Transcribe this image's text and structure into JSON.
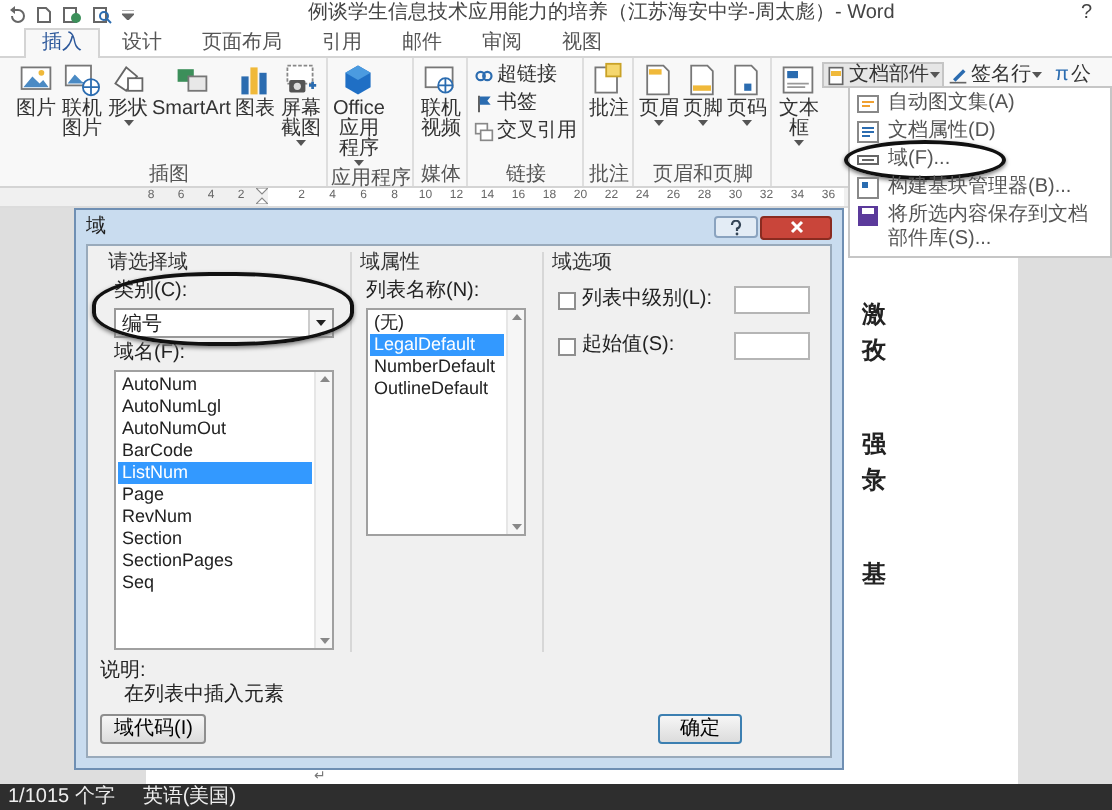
{
  "title_bar": {
    "title": "例谈学生信息技术应用能力的培养（江苏海安中学-周太彪）- Word",
    "help": "?"
  },
  "tabs": [
    {
      "label": "插入",
      "selected": true
    },
    {
      "label": "设计",
      "selected": false
    },
    {
      "label": "页面布局",
      "selected": false
    },
    {
      "label": "引用",
      "selected": false
    },
    {
      "label": "邮件",
      "selected": false
    },
    {
      "label": "审阅",
      "selected": false
    },
    {
      "label": "视图",
      "selected": false
    }
  ],
  "ribbon": {
    "groups": [
      {
        "label": "插图",
        "items": [
          {
            "kind": "large",
            "label": "图片",
            "dropdown": false
          },
          {
            "kind": "large",
            "label": "联机图片",
            "dropdown": false
          },
          {
            "kind": "large",
            "label": "形状",
            "dropdown": true
          },
          {
            "kind": "large",
            "label": "SmartArt",
            "dropdown": false
          },
          {
            "kind": "large",
            "label": "图表",
            "dropdown": false
          },
          {
            "kind": "large",
            "label": "屏幕截图",
            "dropdown": true
          }
        ]
      },
      {
        "label": "应用程序",
        "items": [
          {
            "kind": "large",
            "label": "Office",
            "sublabel": "应用程序",
            "dropdown": true
          }
        ]
      },
      {
        "label": "媒体",
        "items": [
          {
            "kind": "large",
            "label": "联机视频",
            "dropdown": false
          }
        ]
      },
      {
        "label": "链接",
        "items": [
          {
            "kind": "column",
            "buttons": [
              {
                "label": "超链接",
                "dropdown": false,
                "pressed": false
              },
              {
                "label": "书签",
                "dropdown": false,
                "pressed": false
              },
              {
                "label": "交叉引用",
                "dropdown": false,
                "pressed": false
              }
            ]
          }
        ]
      },
      {
        "label": "批注",
        "items": [
          {
            "kind": "large",
            "label": "批注",
            "dropdown": false
          }
        ]
      },
      {
        "label": "页眉和页脚",
        "items": [
          {
            "kind": "large",
            "label": "页眉",
            "dropdown": true
          },
          {
            "kind": "large",
            "label": "页脚",
            "dropdown": true
          },
          {
            "kind": "large",
            "label": "页码",
            "dropdown": true
          }
        ]
      },
      {
        "items": [
          {
            "kind": "large",
            "label": "文本框",
            "dropdown": true
          },
          {
            "kind": "column",
            "buttons": [
              {
                "label": "文档部件",
                "dropdown": true,
                "pressed": true
              }
            ]
          },
          {
            "kind": "column",
            "buttons": [
              {
                "label": "签名行",
                "dropdown": true,
                "pressed": false
              }
            ]
          }
        ]
      },
      {
        "items": [
          {
            "kind": "column",
            "buttons": [
              {
                "symbol": "π",
                "label": "公",
                "dropdown": false,
                "pressed": false
              }
            ]
          }
        ]
      }
    ]
  },
  "menu": {
    "items": [
      {
        "label": "自动图文集(A)",
        "circled": false
      },
      {
        "label": "文档属性(D)",
        "circled": false
      },
      {
        "label": "域(F)...",
        "circled": true
      },
      {
        "label": "构建基块管理器(B)...",
        "circled": false
      },
      {
        "label": "将所选内容保存到文档部件库(S)...",
        "circled": false
      }
    ]
  },
  "ruler": {
    "left_marks": [
      "8",
      "6",
      "4",
      "2"
    ],
    "right_marks": [
      "2",
      "4",
      "6",
      "8",
      "10",
      "12",
      "14",
      "16",
      "18",
      "20",
      "22",
      "24",
      "26",
      "28",
      "30",
      "32",
      "34",
      "36"
    ]
  },
  "document": {
    "blocks": [
      [
        "激",
        "孜"
      ],
      [
        "强",
        "彔"
      ],
      [
        "基"
      ]
    ],
    "paragraph_mark": "↵"
  },
  "dialog": {
    "title": "域",
    "choose": {
      "heading": "请选择域",
      "category_label": "类别(C):",
      "category_value": "编号",
      "category_circled": true,
      "names_label": "域名(F):",
      "names": [
        {
          "label": "AutoNum",
          "selected": false
        },
        {
          "label": "AutoNumLgl",
          "selected": false
        },
        {
          "label": "AutoNumOut",
          "selected": false
        },
        {
          "label": "BarCode",
          "selected": false
        },
        {
          "label": "ListNum",
          "selected": true
        },
        {
          "label": "Page",
          "selected": false
        },
        {
          "label": "RevNum",
          "selected": false
        },
        {
          "label": "Section",
          "selected": false
        },
        {
          "label": "SectionPages",
          "selected": false
        },
        {
          "label": "Seq",
          "selected": false
        }
      ]
    },
    "properties": {
      "heading": "域属性",
      "list_label": "列表名称(N):",
      "lists": [
        {
          "label": "(无)",
          "selected": false
        },
        {
          "label": "LegalDefault",
          "selected": true
        },
        {
          "label": "NumberDefault",
          "selected": false
        },
        {
          "label": "OutlineDefault",
          "selected": false
        }
      ]
    },
    "options": {
      "heading": "域选项",
      "rows": [
        {
          "label": "列表中级别(L):",
          "checked": false
        },
        {
          "label": "起始值(S):",
          "checked": false
        }
      ]
    },
    "description_label": "说明:",
    "description": "在列表中插入元素",
    "field_codes_button": "域代码(I)",
    "ok_button": "确定"
  },
  "status_bar": {
    "word_count": "1/1015 个字",
    "language": "英语(美国)"
  }
}
